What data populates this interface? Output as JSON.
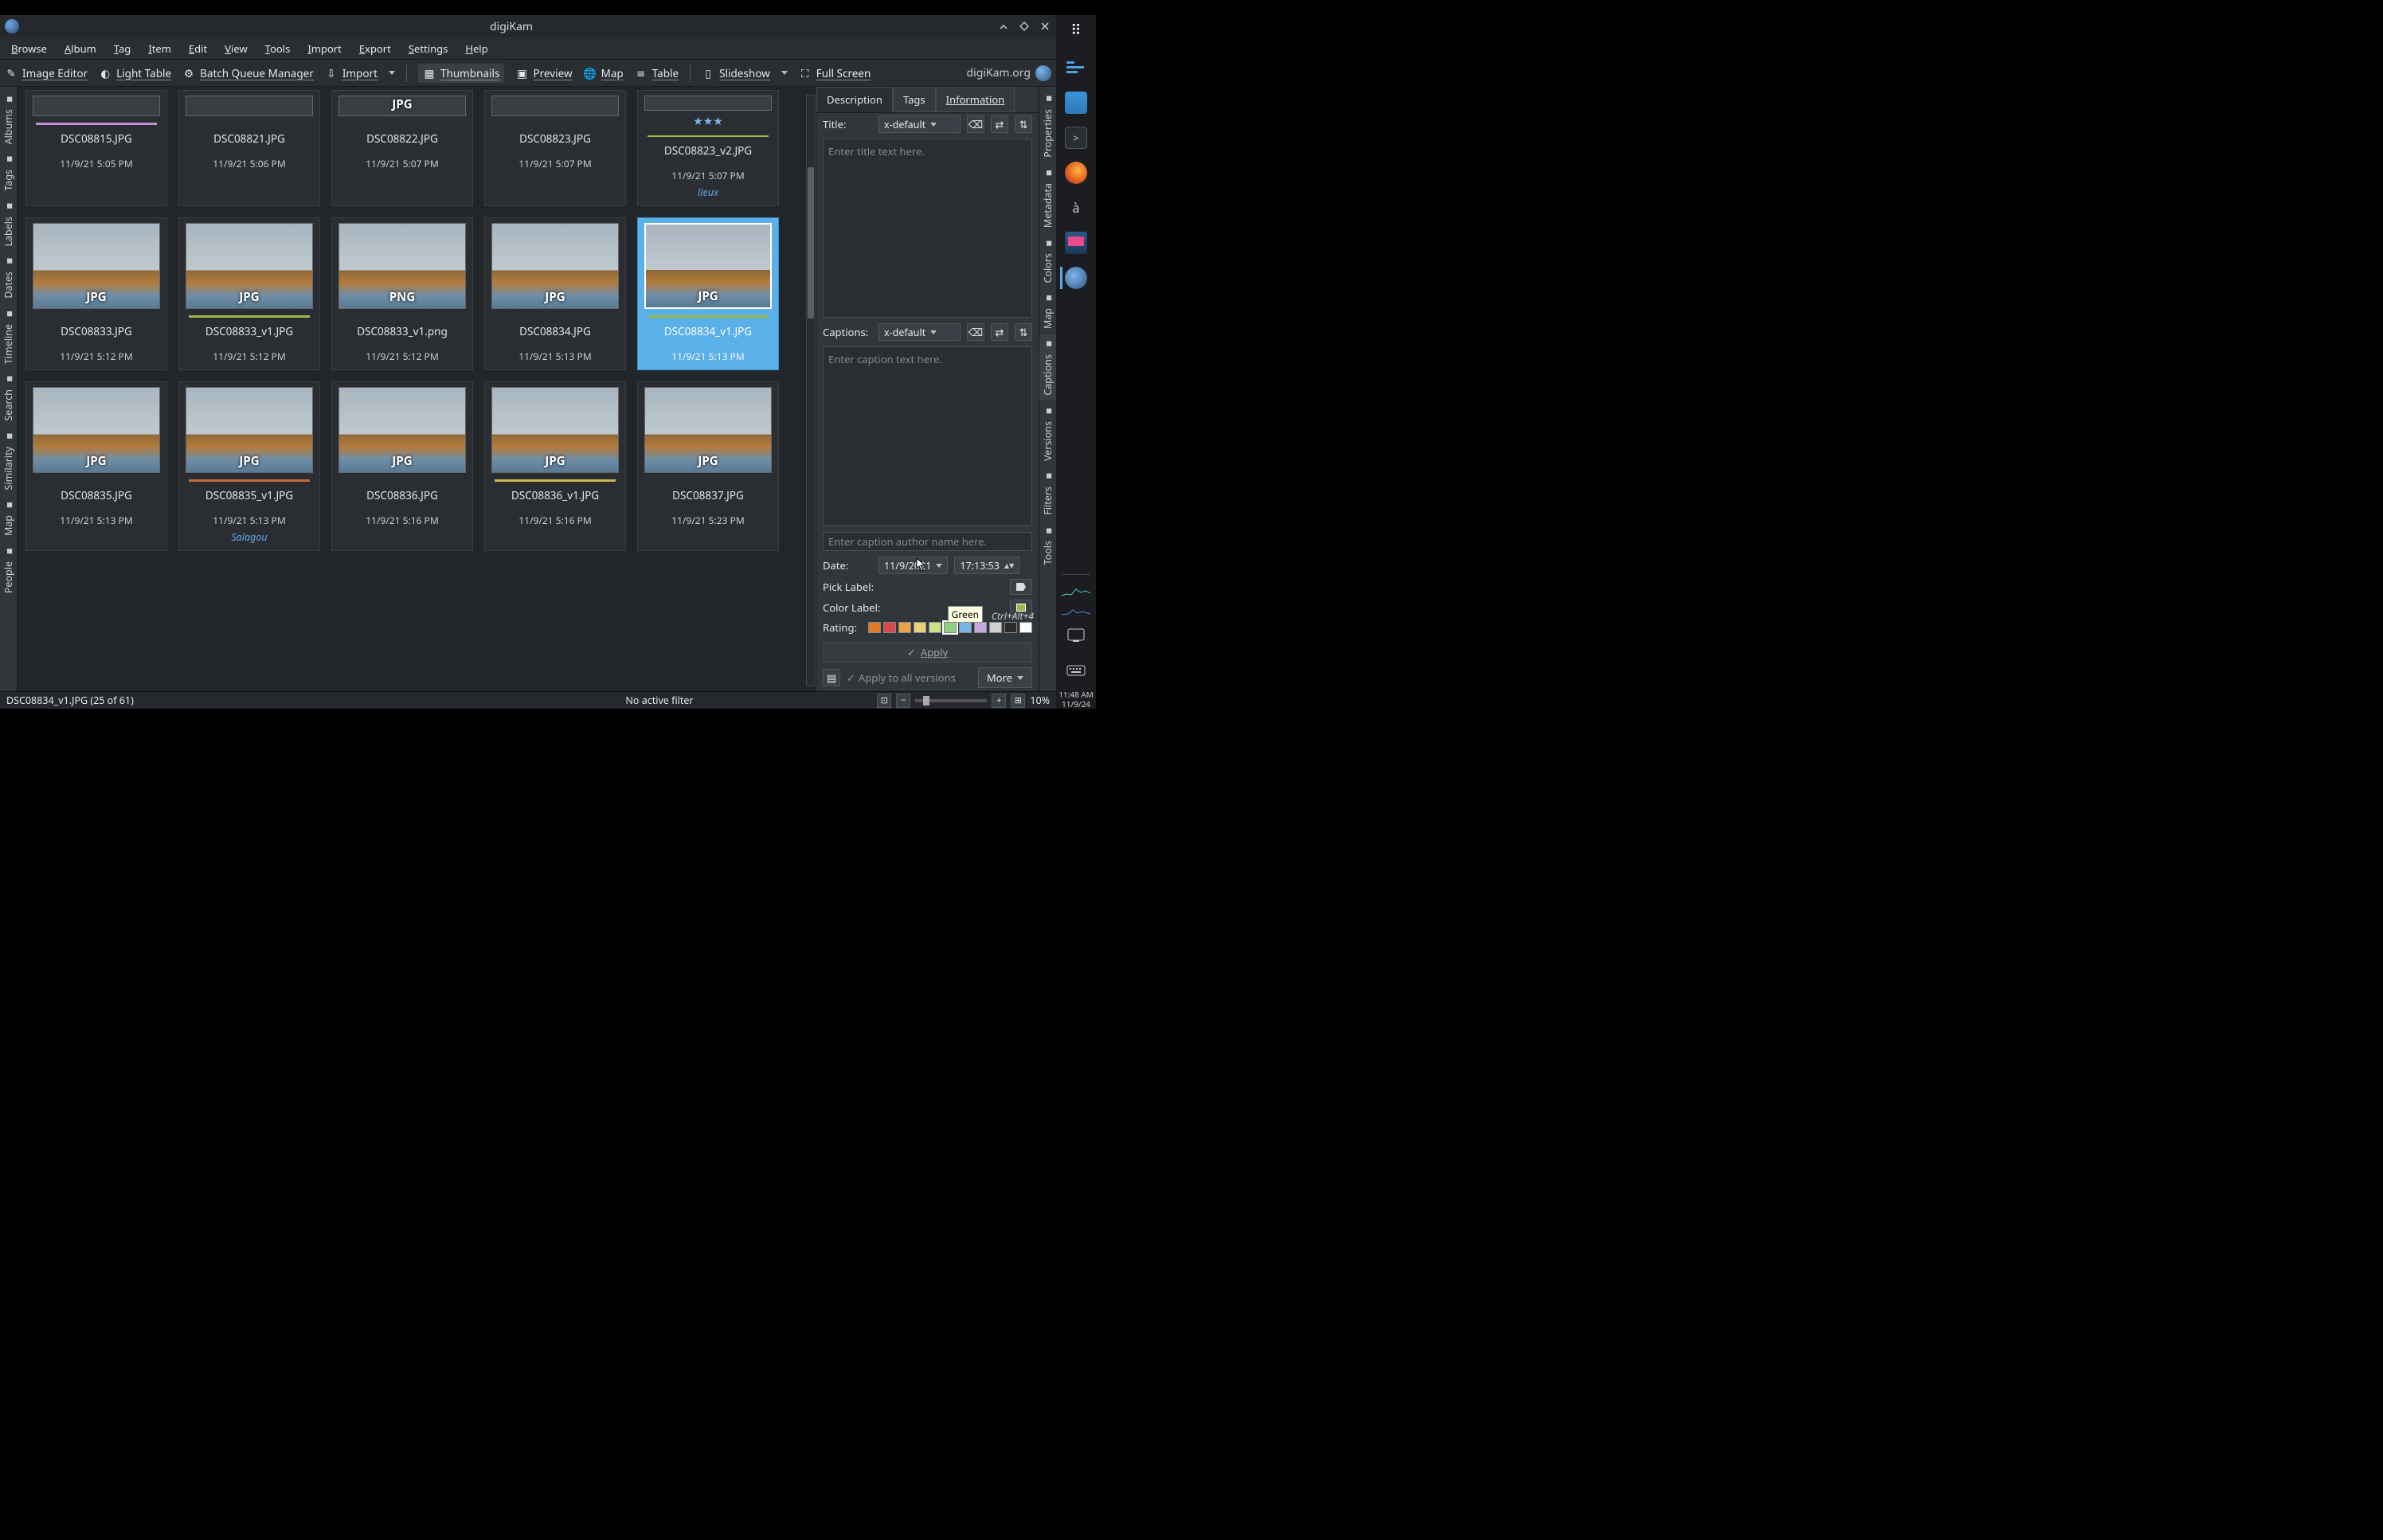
{
  "titlebar": {
    "title": "digiKam"
  },
  "menus": [
    "Browse",
    "Album",
    "Tag",
    "Item",
    "Edit",
    "View",
    "Tools",
    "Import",
    "Export",
    "Settings",
    "Help"
  ],
  "toolbar": {
    "image_editor": "Image Editor",
    "light_table": "Light Table",
    "bqm": "Batch Queue Manager",
    "import": "Import",
    "thumbnails": "Thumbnails",
    "preview": "Preview",
    "map": "Map",
    "table": "Table",
    "slideshow": "Slideshow",
    "fullscreen": "Full Screen",
    "brand": "digiKam.org"
  },
  "left_tabs": [
    "Albums",
    "Tags",
    "Labels",
    "Dates",
    "Timeline",
    "Search",
    "Similarity",
    "Map",
    "People"
  ],
  "right_tabs": [
    "Properties",
    "Metadata",
    "Colors",
    "Map",
    "Captions",
    "Versions",
    "Filters",
    "Tools"
  ],
  "thumbs_row1": [
    {
      "file": "DSC08815.JPG",
      "ts": "11/9/21 5:05 PM",
      "ext": "",
      "label": "#c08fd8"
    },
    {
      "file": "DSC08821.JPG",
      "ts": "11/9/21 5:06 PM",
      "ext": "",
      "label": ""
    },
    {
      "file": "DSC08822.JPG",
      "ts": "11/9/21 5:07 PM",
      "ext": "JPG",
      "label": ""
    },
    {
      "file": "DSC08823.JPG",
      "ts": "11/9/21 5:07 PM",
      "ext": "",
      "label": ""
    },
    {
      "file": "DSC08823_v2.JPG",
      "ts": "11/9/21 5:07 PM",
      "ext": "",
      "label": "#9db84a",
      "stars": 3,
      "tag": "lieux"
    }
  ],
  "thumbs_row2": [
    {
      "file": "DSC08833.JPG",
      "ts": "11/9/21 5:12 PM",
      "ext": "JPG",
      "label": ""
    },
    {
      "file": "DSC08833_v1.JPG",
      "ts": "11/9/21 5:12 PM",
      "ext": "JPG",
      "label": "#9db84a"
    },
    {
      "file": "DSC08833_v1.png",
      "ts": "11/9/21 5:12 PM",
      "ext": "PNG",
      "label": ""
    },
    {
      "file": "DSC08834.JPG",
      "ts": "11/9/21 5:13 PM",
      "ext": "JPG",
      "label": ""
    },
    {
      "file": "DSC08834_v1.JPG",
      "ts": "11/9/21 5:13 PM",
      "ext": "JPG",
      "label": "#9db84a",
      "selected": true
    }
  ],
  "thumbs_row3": [
    {
      "file": "DSC08835.JPG",
      "ts": "11/9/21 5:13 PM",
      "ext": "JPG",
      "label": ""
    },
    {
      "file": "DSC08835_v1.JPG",
      "ts": "11/9/21 5:13 PM",
      "ext": "JPG",
      "label": "#c46a3a",
      "tag": "Salagou"
    },
    {
      "file": "DSC08836.JPG",
      "ts": "11/9/21 5:16 PM",
      "ext": "JPG",
      "label": ""
    },
    {
      "file": "DSC08836_v1.JPG",
      "ts": "11/9/21 5:16 PM",
      "ext": "JPG",
      "label": "#c8b853"
    },
    {
      "file": "DSC08837.JPG",
      "ts": "11/9/21 5:23 PM",
      "ext": "JPG",
      "label": ""
    }
  ],
  "panel": {
    "tabs": {
      "description": "Description",
      "tags": "Tags",
      "information": "Information"
    },
    "title_label": "Title:",
    "lang": "x-default",
    "title_placeholder": "Enter title text here.",
    "captions_label": "Captions:",
    "caption_placeholder": "Enter caption text here.",
    "author_placeholder": "Enter caption author name here.",
    "date_label": "Date:",
    "date_value": "11/9/2021",
    "time_value": "17:13:53",
    "pick_label": "Pick Label:",
    "color_label": "Color Label:",
    "rating_label": "Rating:",
    "tooltip": "Green",
    "shortcut": "Ctrl+Alt+4",
    "apply": "Apply",
    "apply_all": "Apply to all versions",
    "more": "More",
    "swatches": [
      "#e07b2a",
      "#d84a4a",
      "#e8a24a",
      "#e8cf7a",
      "#cde08a",
      "#8fd080",
      "#7ab5e8",
      "#c8a8e0",
      "#cfcfcf",
      "#2a2a2a",
      "#ffffff"
    ]
  },
  "status": {
    "left": "DSC08834_v1.JPG (25 of 61)",
    "center": "No active filter",
    "zoom": "10%"
  },
  "dock": {
    "accel": "à",
    "clock_time": "11:48 AM",
    "clock_date": "11/9/24"
  }
}
